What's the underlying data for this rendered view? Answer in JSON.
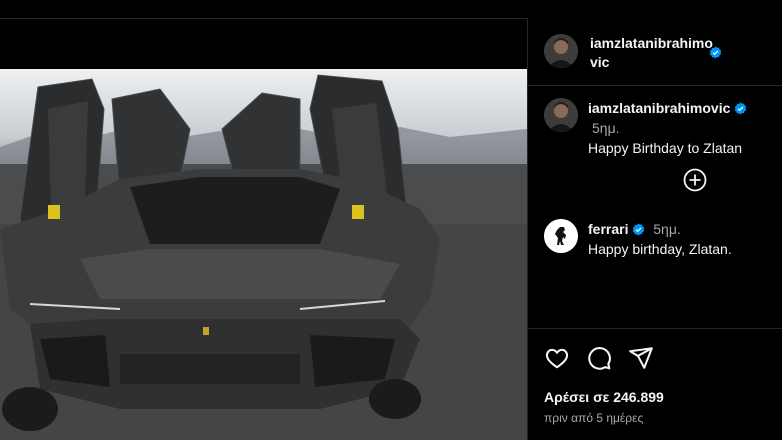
{
  "post": {
    "author": "iamzlatanibrahimovic",
    "author_verified": true
  },
  "comments": [
    {
      "user": "iamzlatanibrahimovic",
      "verified": true,
      "time": "5ημ.",
      "text": "Happy Birthday to Zlatan"
    },
    {
      "user": "ferrari",
      "verified": true,
      "time": "5ημ.",
      "text": "Happy birthday, Zlatan."
    }
  ],
  "actions": {
    "likes": "Αρέσει σε 246.899",
    "posted_ago": "πριν από 5 ημέρες"
  },
  "icons": {
    "load_more": "plus-circle-icon",
    "like": "heart-icon",
    "comment": "comment-bubble-icon",
    "share": "paper-plane-icon",
    "verified": "verified-badge-icon"
  },
  "colors": {
    "background": "#000000",
    "verified": "#0095f6",
    "muted_text": "#a8a8a8"
  }
}
